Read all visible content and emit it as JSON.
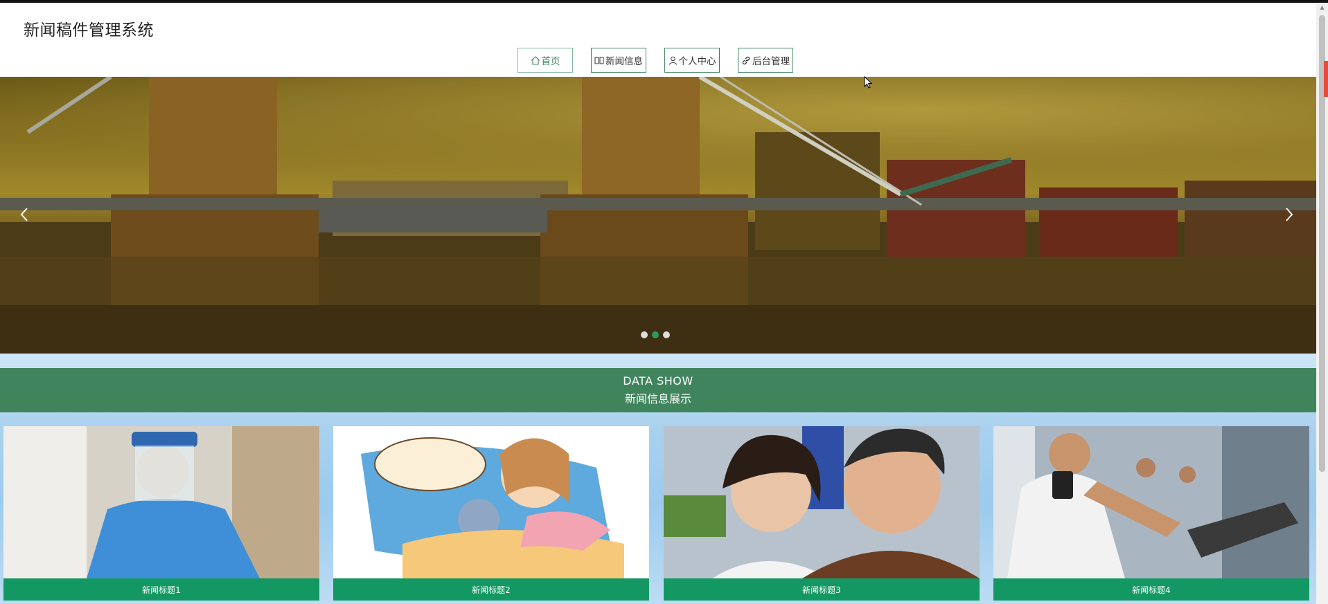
{
  "site": {
    "title": "新闻稿件管理系统"
  },
  "nav": {
    "items": [
      {
        "label": "首页",
        "icon": "home-icon",
        "active": true
      },
      {
        "label": "新闻信息",
        "icon": "columns-icon",
        "active": false
      },
      {
        "label": "个人中心",
        "icon": "user-icon",
        "active": false
      },
      {
        "label": "后台管理",
        "icon": "link-icon",
        "active": false
      }
    ]
  },
  "carousel": {
    "slides": 3,
    "active_index": 1,
    "prev_icon": "chevron-left-icon",
    "next_icon": "chevron-right-icon"
  },
  "section": {
    "title_en": "DATA SHOW",
    "title_cn": "新闻信息展示"
  },
  "news": [
    {
      "title": "新闻标题1"
    },
    {
      "title": "新闻标题2"
    },
    {
      "title": "新闻标题3"
    },
    {
      "title": "新闻标题4"
    }
  ],
  "colors": {
    "accent": "#3f845d",
    "caption": "#139864",
    "dot_active": "#2e9b5e"
  }
}
